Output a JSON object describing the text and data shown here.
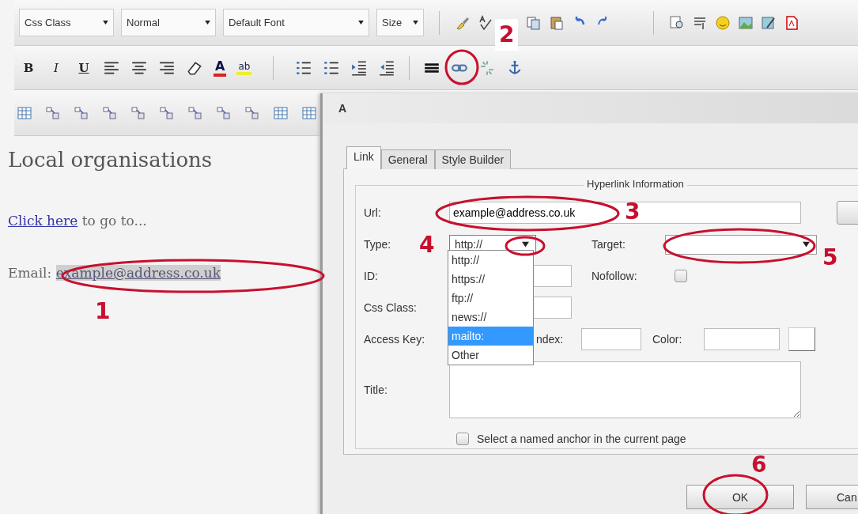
{
  "toolbar": {
    "dropdowns": [
      {
        "label": "Css Class"
      },
      {
        "label": "Normal"
      },
      {
        "label": "Default Font"
      },
      {
        "label": "Size"
      }
    ],
    "format_buttons": [
      {
        "label": "B"
      },
      {
        "label": "I"
      },
      {
        "label": "U"
      }
    ],
    "color_buttons": [
      {
        "label": "A"
      },
      {
        "label": "ab"
      }
    ]
  },
  "editor": {
    "heading": "Local organisations",
    "paragraphs": [
      {
        "parts": [
          {
            "kind": "link",
            "text": "Click here",
            "selected": false
          },
          {
            "kind": "text",
            "text": " to go to..."
          }
        ]
      },
      {
        "parts": [
          {
            "kind": "text",
            "text": "Email: "
          },
          {
            "kind": "link",
            "text": "example@address.co.uk",
            "selected": true
          }
        ]
      }
    ]
  },
  "dialog": {
    "title": "A",
    "tabs": [
      {
        "label": "Link",
        "selected": true
      },
      {
        "label": "General",
        "selected": false
      },
      {
        "label": "Style Builder",
        "selected": false
      }
    ],
    "legend": "Hyperlink Information",
    "url": {
      "label": "Url:",
      "value": "example@address.co.uk"
    },
    "type": {
      "label": "Type:",
      "value": "http://",
      "expanded": true
    },
    "target": {
      "label": "Target:"
    },
    "id": {
      "label": "ID:"
    },
    "nofollow": {
      "label": "Nofollow:",
      "checked": false
    },
    "css_class": {
      "label": "Css Class:"
    },
    "access_key": {
      "label": "Access Key:"
    },
    "tab_index": {
      "label": "ndex:"
    },
    "color": {
      "label": "Color:"
    },
    "title_field": {
      "label": "Title:"
    },
    "anchor": {
      "label": "Select a named anchor in the current page",
      "checked": false
    },
    "type_options": [
      {
        "label": "http://",
        "selected": false
      },
      {
        "label": "https://",
        "selected": false
      },
      {
        "label": "ftp://",
        "selected": false
      },
      {
        "label": "news://",
        "selected": false
      },
      {
        "label": "mailto:",
        "selected": true
      },
      {
        "label": "Other",
        "selected": false
      }
    ],
    "buttons": [
      {
        "label": "OK"
      },
      {
        "label": "Can"
      }
    ]
  },
  "annotations": [
    {
      "label": "1"
    },
    {
      "label": "2"
    },
    {
      "label": "3"
    },
    {
      "label": "4"
    },
    {
      "label": "5"
    },
    {
      "label": "6"
    }
  ]
}
